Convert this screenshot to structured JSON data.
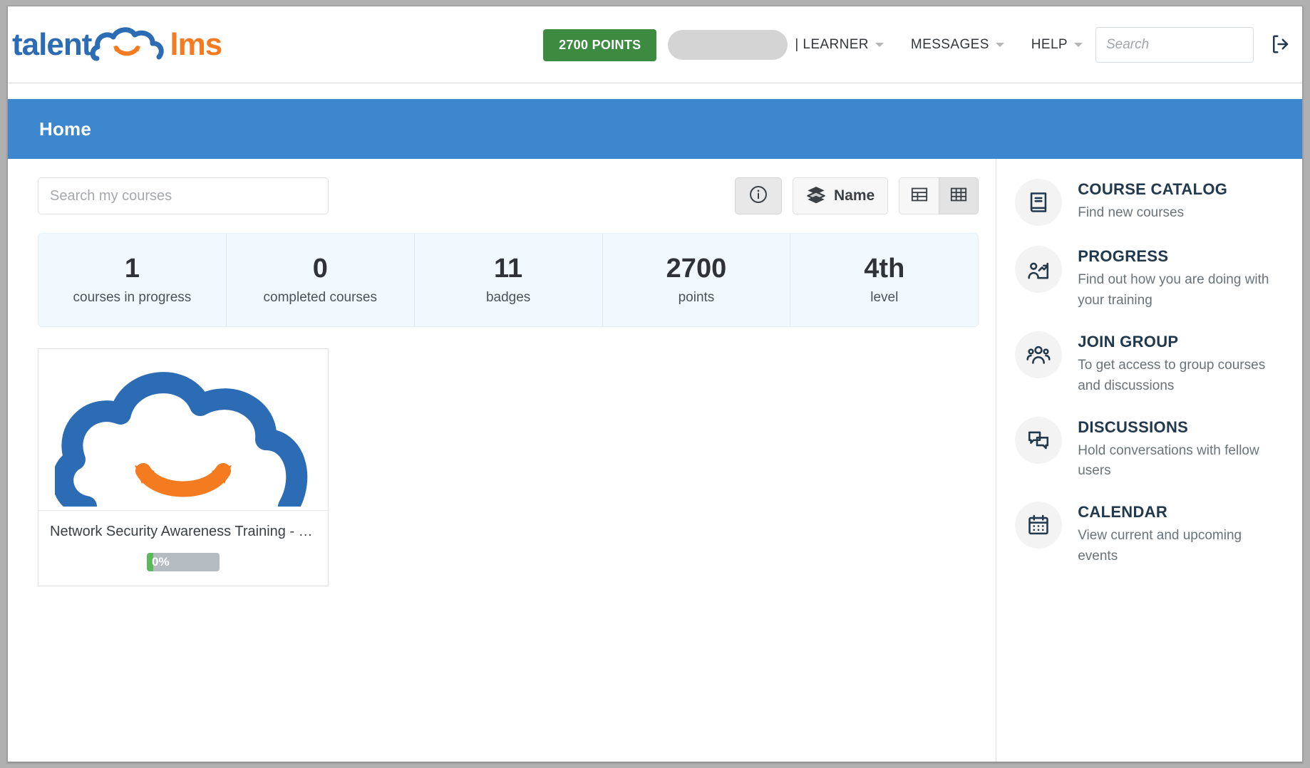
{
  "header": {
    "logo_text_left": "talent",
    "logo_text_right": "lms",
    "logo_icon": "cloud-smile-icon",
    "points_label": "2700 POINTS",
    "user_pill": "",
    "separator": "|",
    "role_label": "LEARNER",
    "messages_label": "MESSAGES",
    "help_label": "HELP",
    "search_placeholder": "Search",
    "search_value": "",
    "logout_icon": "logout-icon"
  },
  "page": {
    "title": "Home"
  },
  "toolbar": {
    "search_placeholder": "Search my courses",
    "search_value": "",
    "info_icon": "info-circle-icon",
    "sort_label": "Name",
    "sort_icon": "layers-icon",
    "list_view_icon": "list-view-icon",
    "grid_view_icon": "grid-view-icon",
    "active_view": "grid"
  },
  "stats": [
    {
      "value": "1",
      "label": "courses in progress"
    },
    {
      "value": "0",
      "label": "completed courses"
    },
    {
      "value": "11",
      "label": "badges"
    },
    {
      "value": "2700",
      "label": "points"
    },
    {
      "value": "4th",
      "label": "level"
    }
  ],
  "courses": [
    {
      "title": "Network Security Awareness Training - H...",
      "progress_text": "0%",
      "progress_value": 0,
      "thumb_icon": "cloud-smile-icon"
    }
  ],
  "sidebar": [
    {
      "title": "COURSE CATALOG",
      "desc": "Find new courses",
      "icon": "book-icon"
    },
    {
      "title": "PROGRESS",
      "desc": "Find out how you are doing with your training",
      "icon": "progress-person-chart-icon"
    },
    {
      "title": "JOIN GROUP",
      "desc": "To get access to group courses and discussions",
      "icon": "people-group-icon"
    },
    {
      "title": "DISCUSSIONS",
      "desc": "Hold conversations with fellow users",
      "icon": "chat-bubbles-icon"
    },
    {
      "title": "CALENDAR",
      "desc": "View current and upcoming events",
      "icon": "calendar-icon"
    }
  ],
  "colors": {
    "brand_blue": "#2c6cb5",
    "brand_orange": "#f47b20",
    "title_bar_blue": "#3c87ce",
    "points_green": "#3d8b40",
    "progress_green": "#5cb85c",
    "stats_bg": "#f2f9fe",
    "sidebar_title": "#22384d"
  }
}
